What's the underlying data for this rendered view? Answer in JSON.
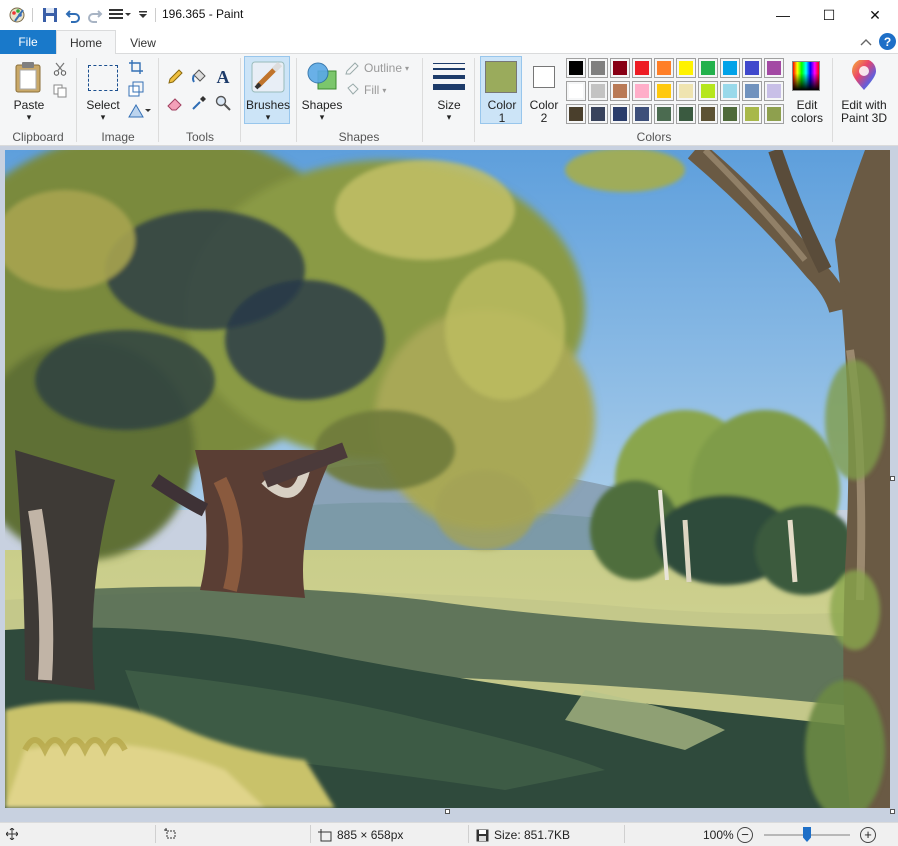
{
  "window": {
    "title": "196.365 - Paint",
    "minimize_glyph": "—",
    "maximize_glyph": "☐",
    "close_glyph": "✕"
  },
  "tabs": {
    "file": "File",
    "home": "Home",
    "view": "View"
  },
  "ribbon": {
    "clipboard": {
      "paste": "Paste",
      "group": "Clipboard"
    },
    "image": {
      "select": "Select",
      "group": "Image"
    },
    "tools": {
      "group": "Tools",
      "text_glyph": "A"
    },
    "brushes": {
      "label": "Brushes"
    },
    "shapes": {
      "label": "Shapes",
      "outline": "Outline",
      "fill": "Fill",
      "group": "Shapes"
    },
    "size": {
      "label": "Size"
    },
    "colors": {
      "color1_label": "Color",
      "color1_num": "1",
      "color1_value": "#9aab5c",
      "color2_label": "Color",
      "color2_num": "2",
      "color2_value": "#ffffff",
      "edit_colors_line1": "Edit",
      "edit_colors_line2": "colors",
      "group": "Colors",
      "palette": [
        "#000000",
        "#7f7f7f",
        "#880015",
        "#ed1c24",
        "#ff7f27",
        "#fff200",
        "#22b14c",
        "#00a2e8",
        "#3f48cc",
        "#a349a4",
        "#ffffff",
        "#c3c3c3",
        "#b97a57",
        "#ffaec9",
        "#ffc90e",
        "#efe4b0",
        "#b5e61d",
        "#99d9ea",
        "#7092be",
        "#c8bfe7",
        "#4a3f2c",
        "#39435c",
        "#2b3d6b",
        "#3d4f7a",
        "#4b6b50",
        "#3a5a40",
        "#5c5234",
        "#4f6a3a",
        "#a8b84a",
        "#8ea04e"
      ]
    },
    "paint3d": {
      "line1": "Edit with",
      "line2": "Paint 3D"
    }
  },
  "statusbar": {
    "dimensions": "885 × 658px",
    "size": "Size: 851.7KB",
    "zoom": "100%",
    "zoom_level_pct": 100
  },
  "icons": {
    "app": "paint-app-icon",
    "save": "save-icon",
    "undo": "undo-icon",
    "redo": "redo-icon",
    "help": "help-icon"
  }
}
